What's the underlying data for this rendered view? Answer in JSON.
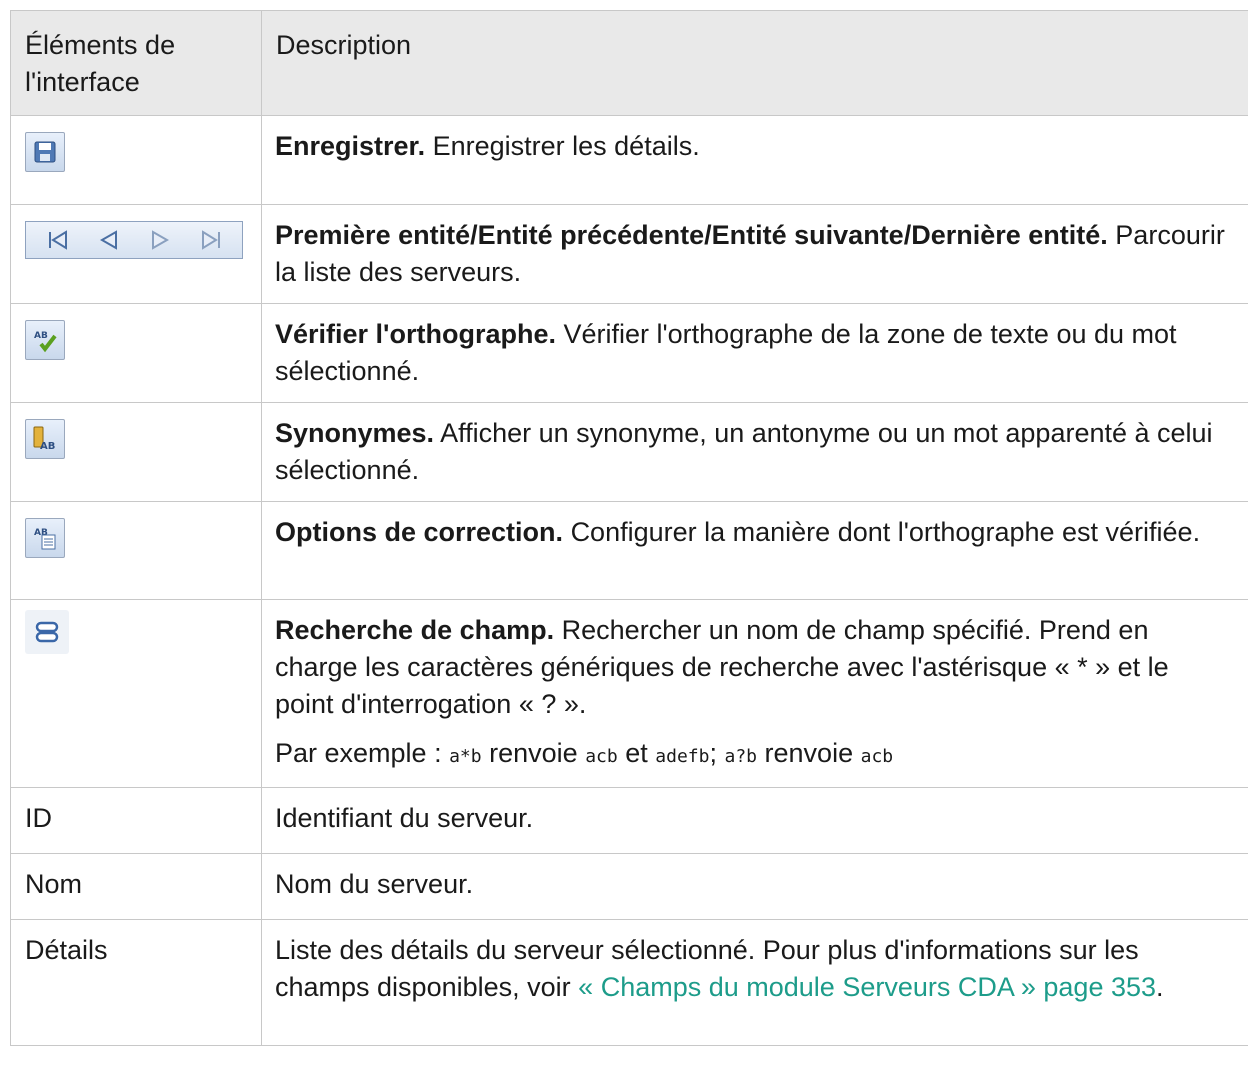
{
  "header": {
    "col1": "Éléments de l'interface",
    "col2": "Description"
  },
  "rows": [
    {
      "icon": "save-icon",
      "title": "Enregistrer.",
      "text": "Enregistrer les détails."
    },
    {
      "icon": "navigation-icons",
      "title": "Première entité/Entité précédente/Entité suivante/Dernière entité.",
      "text": "Parcourir la liste des serveurs."
    },
    {
      "icon": "spell-check-icon",
      "title": "Vérifier l'orthographe.",
      "text": "Vérifier l'orthographe de la zone de texte ou du mot sélectionné."
    },
    {
      "icon": "thesaurus-icon",
      "title": "Synonymes.",
      "text": "Afficher un synonyme, un antonyme ou un mot apparenté à celui sélectionné."
    },
    {
      "icon": "spelling-options-icon",
      "title": "Options de correction.",
      "text": "Configurer la manière dont l'orthographe est vérifiée."
    },
    {
      "icon": "field-search-icon",
      "title": "Recherche de champ.",
      "text": "Rechercher un nom de champ spécifié. Prend en charge les caractères génériques de recherche avec l'astérisque « * » et le point d'interrogation « ? ».",
      "example": {
        "prefix": "Par exemple :",
        "code1": "a*b",
        "w1": "renvoie",
        "code2": "acb",
        "w2": "et",
        "code3": "adefb",
        "sep": ";",
        "code4": "a?b",
        "w3": "renvoie",
        "code5": "acb"
      }
    },
    {
      "label": "ID",
      "text": "Identifiant du serveur."
    },
    {
      "label": "Nom",
      "text": "Nom du serveur."
    },
    {
      "label": "Détails",
      "text": "Liste des détails du serveur sélectionné. Pour plus d'informations sur les champs disponibles, voir",
      "link": "« Champs du module Serveurs CDA » page 353",
      "end": "."
    }
  ],
  "colors": {
    "header_bg": "#e9e9e9",
    "border": "#c8c8c8",
    "link": "#1d9c8a"
  }
}
